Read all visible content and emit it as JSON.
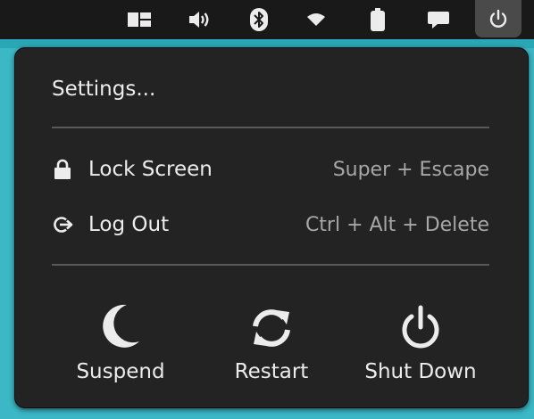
{
  "panel": {
    "indicators": [
      {
        "icon": "workspaces-icon"
      },
      {
        "icon": "volume-icon"
      },
      {
        "icon": "bluetooth-icon"
      },
      {
        "icon": "wifi-icon"
      },
      {
        "icon": "battery-icon"
      },
      {
        "icon": "notifications-icon"
      },
      {
        "icon": "power-icon",
        "active": true
      }
    ]
  },
  "menu": {
    "settings_label": "Settings...",
    "lock": {
      "label": "Lock Screen",
      "accel": "Super + Escape",
      "icon": "lock-icon"
    },
    "logout": {
      "label": "Log Out",
      "accel": "Ctrl + Alt + Delete",
      "icon": "logout-icon"
    },
    "actions": {
      "suspend": {
        "label": "Suspend",
        "icon": "moon-icon"
      },
      "restart": {
        "label": "Restart",
        "icon": "restart-icon"
      },
      "shutdown": {
        "label": "Shut Down",
        "icon": "power-icon"
      }
    }
  },
  "colors": {
    "panel_bg": "#191919",
    "menu_bg": "#232323",
    "desktop": "#3bb7c6",
    "text": "#ececec",
    "accel_text": "#a7a7a7"
  }
}
